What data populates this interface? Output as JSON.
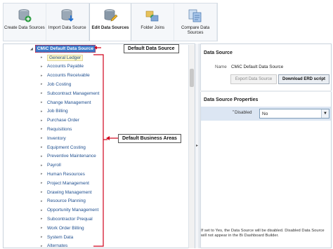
{
  "ribbon": [
    {
      "label": "Create Data Sources",
      "icon": "database-add-icon",
      "active": false
    },
    {
      "label": "Import Data Source",
      "icon": "database-import-icon",
      "active": false
    },
    {
      "label": "Edit Data Sources",
      "icon": "database-edit-icon",
      "active": true
    },
    {
      "label": "Folder Joins",
      "icon": "folder-joins-icon",
      "active": false
    },
    {
      "label": "Compare Data Sources",
      "icon": "compare-sources-icon",
      "active": false
    }
  ],
  "tree": {
    "root": "CMiC Default Data Source",
    "items": [
      "General Ledger",
      "Accounts Payable",
      "Accounts Receivable",
      "Job Costing",
      "Subcontract Management",
      "Change Management",
      "Job Billing",
      "Purchase Order",
      "Requisitions",
      "Inventory",
      "Equipment Costing",
      "Preventive Maintenance",
      "Payroll",
      "Human Resources",
      "Project Management",
      "Drawing Management",
      "Resource Planning",
      "Opportunity Management",
      "Subcontractor Prequal",
      "Work Order Billing",
      "System Data",
      "Alternates"
    ]
  },
  "callouts": {
    "default_source": "Default Data Source",
    "business_areas": "Default Business Areas"
  },
  "panel": {
    "title": "Data Source",
    "name_label": "Name",
    "name_value": "CMiC Default Data Source",
    "export_btn": "Export Data Source",
    "erd_btn": "Download ERD script",
    "props_title": "Data Source Properties",
    "required_mark": "*",
    "disabled_label": "Disabled",
    "disabled_value": "No",
    "help": "If set to Yes, the Data Source will be disabled. Disabled Data Source will not appear in the Bi Dashboard Builder."
  },
  "colors": {
    "accent": "#3a79c9",
    "callout_red": "#d0021b",
    "link": "#1f4f8f"
  }
}
